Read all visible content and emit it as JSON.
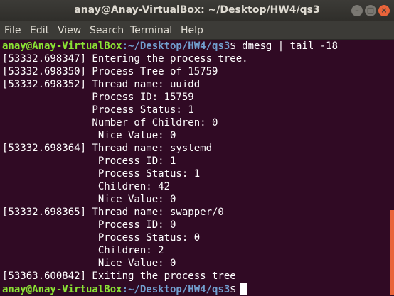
{
  "window": {
    "title": "anay@Anay-VirtualBox: ~/Desktop/HW4/qs3"
  },
  "title_buttons": {
    "minimize": "–",
    "maximize": "□",
    "close": "×"
  },
  "menu": [
    "File",
    "Edit",
    "View",
    "Search",
    "Terminal",
    "Help"
  ],
  "prompt": {
    "user": "anay@Anay-VirtualBox",
    "path": ":~/Desktop/HW4/qs3",
    "symbol": "$",
    "command": " dmesg | tail -18"
  },
  "output": [
    "[53332.698347] Entering the process tree.",
    "[53332.698350] Process Tree of 15759",
    "[53332.698352] Thread name: uuidd",
    "               Process ID: 15759",
    "               Process Status: 1",
    "               Number of Children: 0",
    "                Nice Value: 0",
    "[53332.698364] Thread name: systemd",
    "                Process ID: 1",
    "                Process Status: 1",
    "                Children: 42",
    "                Nice Value: 0",
    "[53332.698365] Thread name: swapper/0",
    "                Process ID: 0",
    "                Process Status: 0",
    "                Children: 2",
    "                Nice Value: 0",
    "[53363.600842] Exiting the process tree"
  ],
  "final_prompt": {
    "user": "anay@Anay-VirtualBox",
    "path": ":~/Desktop/HW4/qs3",
    "symbol": "$"
  },
  "colors": {
    "background": "#300a24",
    "prompt_user": "#8ae234",
    "prompt_path": "#729fcf",
    "scrollbar": "#e9643a"
  }
}
